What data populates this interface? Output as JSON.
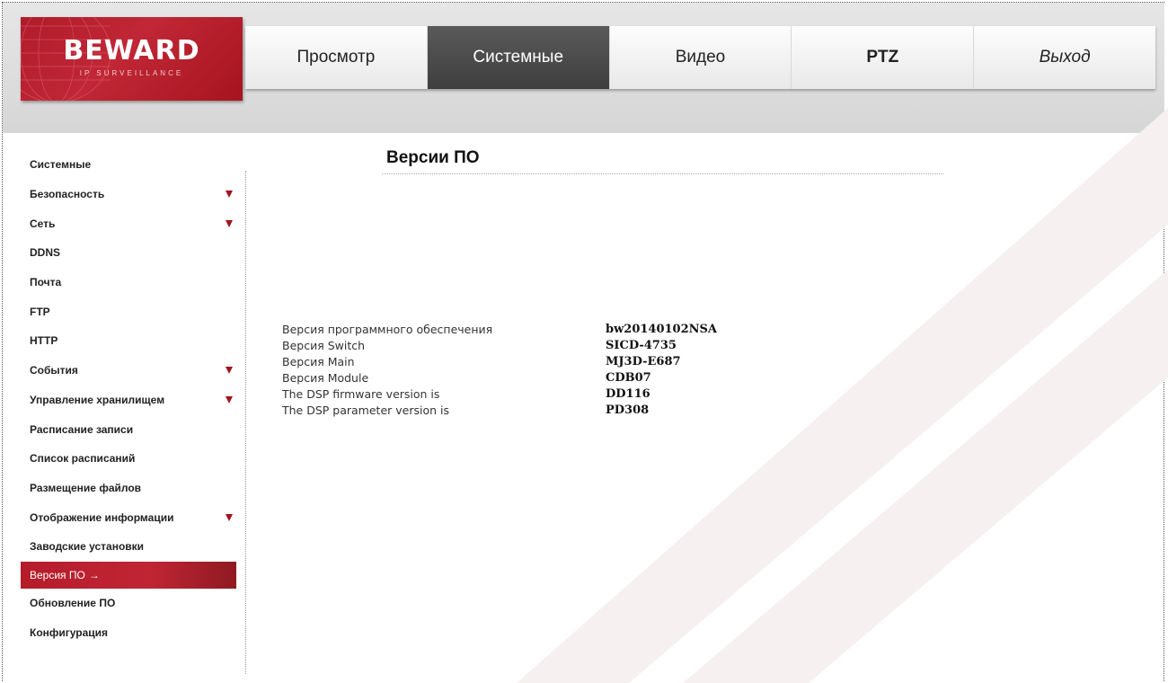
{
  "logo": {
    "title": "BEWARD",
    "subtitle": "IP SURVEILLANCE"
  },
  "nav": [
    {
      "label": "Просмотр"
    },
    {
      "label": "Системные"
    },
    {
      "label": "Видео"
    },
    {
      "label": "PTZ"
    },
    {
      "label": "Выход"
    }
  ],
  "nav_active": "Системные",
  "sidebar": {
    "items": [
      {
        "label": "Системные",
        "has_submenu": false
      },
      {
        "label": "Безопасность",
        "has_submenu": true
      },
      {
        "label": "Сеть",
        "has_submenu": true
      },
      {
        "label": "DDNS",
        "has_submenu": false
      },
      {
        "label": "Почта",
        "has_submenu": false
      },
      {
        "label": "FTP",
        "has_submenu": false
      },
      {
        "label": "HTTP",
        "has_submenu": false
      },
      {
        "label": "События",
        "has_submenu": true
      },
      {
        "label": "Управление хранилищем",
        "has_submenu": true
      },
      {
        "label": "Расписание записи",
        "has_submenu": false
      },
      {
        "label": "Список расписаний",
        "has_submenu": false
      },
      {
        "label": "Размещение файлов",
        "has_submenu": false
      },
      {
        "label": "Отображение информации",
        "has_submenu": true
      },
      {
        "label": "Заводские установки",
        "has_submenu": false
      },
      {
        "label": "Версия ПО",
        "has_submenu": false,
        "active": true,
        "arrow": "→"
      },
      {
        "label": "Обновление ПО",
        "has_submenu": false
      },
      {
        "label": "Конфигурация",
        "has_submenu": false
      }
    ]
  },
  "main": {
    "title": "Версии ПО",
    "rows": [
      {
        "label": "Версия программного обеспечения",
        "value": "bw20140102NSA"
      },
      {
        "label": "Версия Switch",
        "value": "SICD-4735"
      },
      {
        "label": "Версия Main",
        "value": "MJ3D-E687"
      },
      {
        "label": "Версия Module",
        "value": "CDB07"
      },
      {
        "label": "The DSP firmware version is",
        "value": "DD116"
      },
      {
        "label": "The DSP parameter version is",
        "value": "PD308"
      }
    ]
  },
  "colors": {
    "brand_red": "#b51c2a",
    "nav_active_bg": "#4a4a4a",
    "submenu_indicator": "#a1141c"
  }
}
